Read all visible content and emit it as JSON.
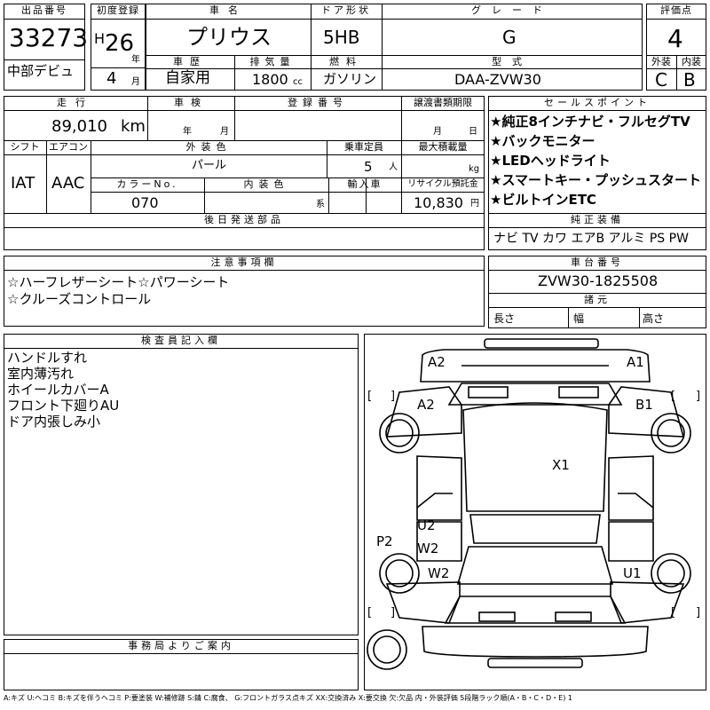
{
  "top": {
    "lot_no_label": "出品番号",
    "lot_no": "33273",
    "debut_label": "中部デビュ",
    "first_reg_label": "初度登録",
    "era": "H",
    "year": "26",
    "year_unit": "年",
    "month": "4",
    "month_unit": "月",
    "car_name_label": "車名",
    "car_name": "プリウス",
    "history_label": "車歴",
    "history": "自家用",
    "door_label": "ドア形状",
    "door": "5HB",
    "displacement_label": "排気量",
    "displacement": "1800",
    "displacement_unit": "cc",
    "fuel_label": "燃料",
    "fuel": "ガソリン",
    "grade_label": "グレード",
    "grade": "G",
    "model_label": "型式",
    "model": "DAA-ZVW30",
    "score_label": "評価点",
    "score": "4",
    "exterior_label": "外装",
    "exterior": "C",
    "interior_label": "内装",
    "interior": "B"
  },
  "mid": {
    "mileage_label": "走行",
    "mileage": "89,010",
    "mileage_unit": "km",
    "inspection_label": "車検",
    "insp_year_unit": "年",
    "insp_month_unit": "月",
    "reg_no_label": "登録番号",
    "transfer_label": "譲渡書類期限",
    "transfer_month_unit": "月",
    "transfer_day_unit": "日",
    "shift_label": "シフト",
    "shift": "IAT",
    "ac_label": "エアコン",
    "ac": "AAC",
    "ext_color_label": "外装色",
    "ext_color": "パール",
    "capacity_label": "乗車定員",
    "capacity": "5",
    "capacity_unit": "人",
    "max_load_label": "最大積載量",
    "max_load_unit": "kg",
    "color_no_label": "カラーNo.",
    "color_no": "070",
    "int_color_label": "内装色",
    "int_color_unit": "系",
    "import_label": "輸入車",
    "recycle_label": "リサイクル預託金",
    "recycle": "10,830",
    "recycle_unit": "円",
    "later_parts_label": "後日発送部品"
  },
  "sales": {
    "label": "セールスポイント",
    "points": [
      "★純正8インチナビ・フルセグTV",
      "★バックモニター",
      "★LEDヘッドライト",
      "★スマートキー・プッシュスタート",
      "★ビルトインETC"
    ],
    "equip_label": "純正装備",
    "equip": "ナビ TV カワ エアB アルミ PS PW"
  },
  "notes": {
    "label": "注意事項欄",
    "lines": [
      "☆ハーフレザーシート☆パワーシート",
      "☆クルーズコントロール"
    ]
  },
  "chassis": {
    "label": "車台番号",
    "number": "ZVW30-1825508",
    "spec_label": "諸元",
    "length_label": "長さ",
    "width_label": "幅",
    "height_label": "高さ"
  },
  "inspector": {
    "label": "検査員記入欄",
    "lines": [
      "ハンドルすれ",
      "室内薄汚れ",
      "ホイールカバーA",
      "フロント下廻りAU",
      "ドア内張しみ小"
    ]
  },
  "office": {
    "label": "事務局よりご案内"
  },
  "diagram": {
    "marks": [
      "A2",
      "A1",
      "A2",
      "B1",
      "X1",
      "U2",
      "W2",
      "P2",
      "W2",
      "U1"
    ],
    "brackets": [
      "[",
      "]",
      "[",
      "]",
      "[",
      "]",
      "[",
      "]"
    ]
  },
  "legend": "A:キズ U:ヘコミ B:キズを伴うヘコミ P:要塗装 W:補修跡 S:錆 C:腐食、 G:フロントガラス点キズ XX:交換済み X:要交換 欠:欠品 内・外装評価 5段階ラック順(A・B・C・D・E) 1"
}
